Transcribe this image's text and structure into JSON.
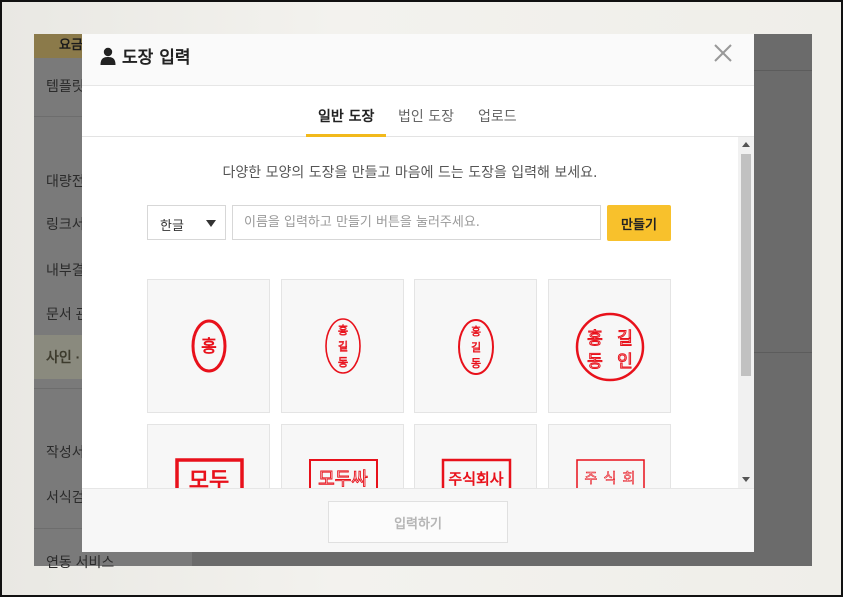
{
  "background_app": {
    "top_button_label": "요금",
    "sidebar_items": [
      "템플릿",
      "대량전",
      "링크서",
      "내부결",
      "문서 관",
      "사인 ·",
      "작성서",
      "서식검",
      "연동 서비스"
    ]
  },
  "modal": {
    "title": "도장 입력",
    "close_label": "×",
    "tabs": [
      {
        "label": "일반 도장",
        "active": true
      },
      {
        "label": "법인 도장",
        "active": false
      },
      {
        "label": "업로드",
        "active": false
      }
    ],
    "description": "다양한 모양의 도장을 만들고 마음에 드는 도장을 입력해 보세요.",
    "language_select": {
      "selected": "한글"
    },
    "name_input": {
      "value": "",
      "placeholder": "이름을 입력하고 만들기 버튼을 눌러주세요."
    },
    "make_button_label": "만들기",
    "stamps": [
      {
        "text": "홍",
        "style": "ellipse-single"
      },
      {
        "text": "홍길동",
        "style": "ellipse-outline-vertical"
      },
      {
        "text": "홍길동",
        "style": "ellipse-vertical"
      },
      {
        "text": "홍길동인",
        "style": "circle-grid"
      },
      {
        "text": "모두",
        "style": "rect-bold"
      },
      {
        "text": "모두싸",
        "style": "rect-outline"
      },
      {
        "text": "주식회사",
        "style": "rect-corporate"
      },
      {
        "text": "주식회사",
        "style": "square-seal"
      }
    ],
    "submit_button_label": "입력하기"
  },
  "colors": {
    "accent": "#f8c12c",
    "stamp_red": "#e8111b"
  }
}
